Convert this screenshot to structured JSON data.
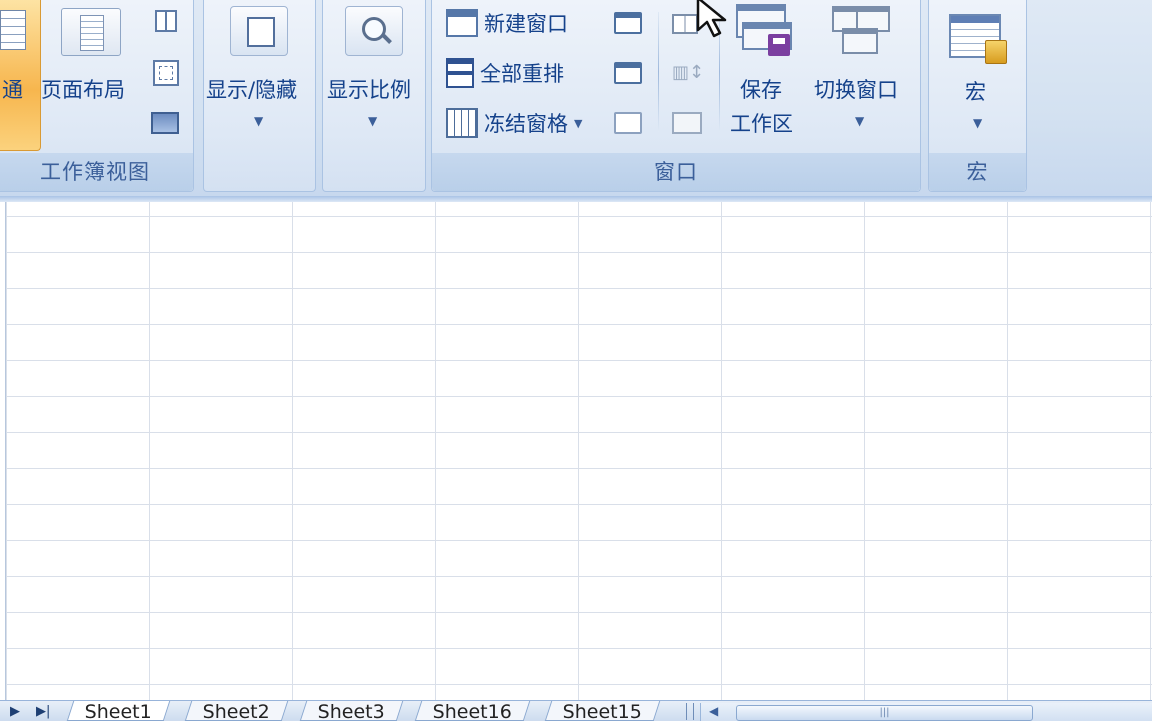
{
  "ribbon": {
    "workbook_views": {
      "group_label": "工作簿视图",
      "normal_label": "通",
      "page_layout_label": "页面布局"
    },
    "show_hide": {
      "label": "显示/隐藏"
    },
    "zoom": {
      "label": "显示比例"
    },
    "window": {
      "group_label": "窗口",
      "new_window": "新建窗口",
      "arrange_all": "全部重排",
      "freeze_panes": "冻结窗格",
      "save_workspace_line1": "保存",
      "save_workspace_line2": "工作区",
      "switch_windows": "切换窗口"
    },
    "macros": {
      "group_label": "宏",
      "label": "宏"
    }
  },
  "sheet_tabs": [
    "Sheet1",
    "Sheet2",
    "Sheet3",
    "Sheet16",
    "Sheet15"
  ],
  "active_sheet": "Sheet1",
  "colors": {
    "ribbon_bg": "#dfe9f5",
    "accent_text": "#15428b",
    "active_view": "#f9c65a"
  }
}
